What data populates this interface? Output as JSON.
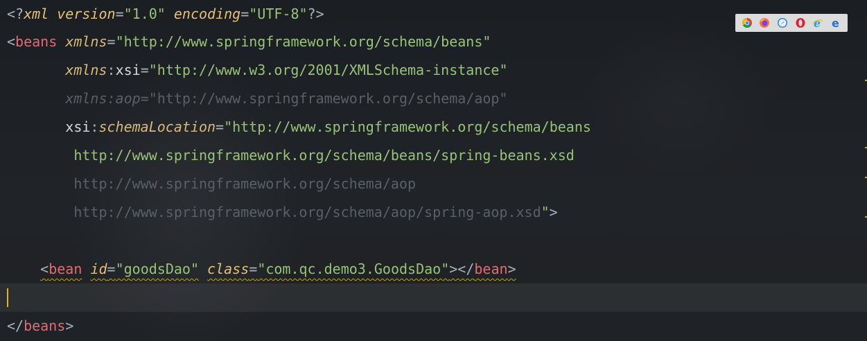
{
  "editor": {
    "lines": [
      {
        "segments": [
          {
            "t": "<?",
            "c": "punc"
          },
          {
            "t": "xml",
            "c": "prolog"
          },
          {
            "t": " ",
            "c": "plain"
          },
          {
            "t": "version",
            "c": "prolog"
          },
          {
            "t": "=",
            "c": "punc"
          },
          {
            "t": "\"1.0\"",
            "c": "str"
          },
          {
            "t": " ",
            "c": "plain"
          },
          {
            "t": "encoding",
            "c": "prolog"
          },
          {
            "t": "=",
            "c": "punc"
          },
          {
            "t": "\"UTF-8\"",
            "c": "str"
          },
          {
            "t": "?>",
            "c": "punc"
          }
        ]
      },
      {
        "segments": [
          {
            "t": "<",
            "c": "punc"
          },
          {
            "t": "beans",
            "c": "tag"
          },
          {
            "t": " ",
            "c": "plain"
          },
          {
            "t": "xmlns",
            "c": "xmlns"
          },
          {
            "t": "=",
            "c": "punc"
          },
          {
            "t": "\"http://www.springframework.org/schema/beans\"",
            "c": "str"
          }
        ]
      },
      {
        "segments": [
          {
            "t": "       ",
            "c": "plain"
          },
          {
            "t": "xmlns",
            "c": "xmlns"
          },
          {
            "t": ":",
            "c": "punc"
          },
          {
            "t": "xsi",
            "c": "plain"
          },
          {
            "t": "=",
            "c": "punc"
          },
          {
            "t": "\"http://www.w3.org/2001/XMLSchema-instance\"",
            "c": "str"
          }
        ]
      },
      {
        "faded": true,
        "segments": [
          {
            "t": "       ",
            "c": "plain"
          },
          {
            "t": "xmlns:aop",
            "c": "attr"
          },
          {
            "t": "=",
            "c": "punc"
          },
          {
            "t": "\"http://www.springframework.org/schema/aop\"",
            "c": "str"
          }
        ]
      },
      {
        "segments": [
          {
            "t": "       ",
            "c": "plain"
          },
          {
            "t": "xsi",
            "c": "plain"
          },
          {
            "t": ":",
            "c": "punc"
          },
          {
            "t": "schemaLocation",
            "c": "xmlns"
          },
          {
            "t": "=",
            "c": "punc"
          },
          {
            "t": "\"http://www.springframework.org/schema/beans",
            "c": "str"
          }
        ]
      },
      {
        "segments": [
          {
            "t": "        ",
            "c": "plain"
          },
          {
            "t": "http://www.springframework.org/schema/beans/spring-beans.xsd",
            "c": "str"
          }
        ]
      },
      {
        "faded": true,
        "segments": [
          {
            "t": "        ",
            "c": "plain"
          },
          {
            "t": "http://www.springframework.org/schema/aop",
            "c": "str"
          }
        ]
      },
      {
        "segments": [
          {
            "t": "        ",
            "c": "plain"
          },
          {
            "t": "http://www.springframework.org/schema/aop/spring-aop.xsd",
            "c": "fadedstr"
          },
          {
            "t": "\"",
            "c": "str"
          },
          {
            "t": ">",
            "c": "punc"
          }
        ]
      },
      {
        "segments": []
      },
      {
        "squiggle": true,
        "segments": [
          {
            "t": "    ",
            "c": "plain"
          },
          {
            "t": "<",
            "c": "punc"
          },
          {
            "t": "bean",
            "c": "tag"
          },
          {
            "t": " ",
            "c": "plain"
          },
          {
            "t": "id",
            "c": "attr"
          },
          {
            "t": "=",
            "c": "punc"
          },
          {
            "t": "\"goodsDao\"",
            "c": "str"
          },
          {
            "t": " ",
            "c": "plain"
          },
          {
            "t": "class",
            "c": "attr"
          },
          {
            "t": "=",
            "c": "punc"
          },
          {
            "t": "\"com.qc.demo3.GoodsDao\"",
            "c": "str"
          },
          {
            "t": "></",
            "c": "punc"
          },
          {
            "t": "bean",
            "c": "tag"
          },
          {
            "t": ">",
            "c": "punc"
          }
        ]
      },
      {
        "segments": []
      },
      {
        "segments": [
          {
            "t": "</",
            "c": "punc"
          },
          {
            "t": "beans",
            "c": "tag"
          },
          {
            "t": ">",
            "c": "punc"
          }
        ]
      }
    ]
  },
  "browser_icons": [
    {
      "name": "chrome-icon",
      "color": "#4285f4"
    },
    {
      "name": "firefox-icon",
      "color": "#ff7139"
    },
    {
      "name": "safari-icon",
      "color": "#1e88e5"
    },
    {
      "name": "opera-icon",
      "color": "#e0202f"
    },
    {
      "name": "ie-icon",
      "color": "#1ea1e0"
    },
    {
      "name": "edge-icon",
      "color": "#1e73d6"
    }
  ]
}
